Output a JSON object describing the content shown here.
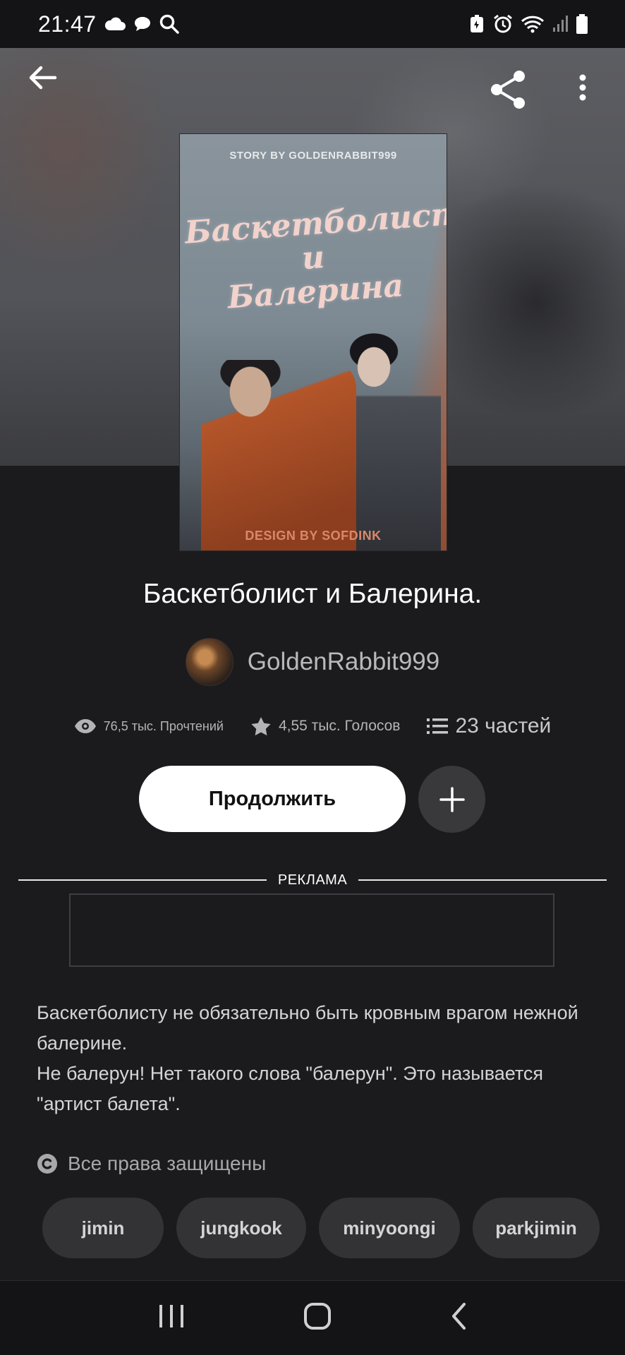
{
  "status_bar": {
    "time": "21:47",
    "left_icons": [
      "cloud-icon",
      "chat-bubble-icon",
      "search-icon"
    ],
    "right_icons": [
      "battery-saver-icon",
      "alarm-icon",
      "wifi-icon",
      "signal-icon",
      "battery-icon"
    ]
  },
  "toolbar": {
    "back_icon": "arrow-left-icon",
    "share_icon": "share-icon",
    "more_icon": "more-vertical-icon"
  },
  "cover": {
    "top_text": "STORY BY GOLDENRABBIT999",
    "title_line1": "Баскетболист",
    "title_line2": "и",
    "title_line3": "Балерина",
    "bottom_text": "DESIGN BY SOFDINK"
  },
  "story": {
    "title": "Баскетболист и Балерина.",
    "author": "GoldenRabbit999",
    "reads": "76,5 тыс. Прочтений",
    "votes": "4,55 тыс. Голосов",
    "parts": "23 частей"
  },
  "actions": {
    "continue_label": "Продолжить",
    "add_icon": "plus-icon"
  },
  "ad": {
    "label": "РЕКЛАМА"
  },
  "description": "Баскетболисту не обязательно быть кровным врагом нежной балерине.\n Не балерун! Нет такого слова \"балерун\". Это называется \"артист балета\".",
  "rights": "Все права защищены",
  "tags": [
    "jimin",
    "jungkook",
    "minyoongi",
    "parkjimin"
  ],
  "nav_bar": [
    "recent-apps-icon",
    "home-icon",
    "back-icon"
  ]
}
